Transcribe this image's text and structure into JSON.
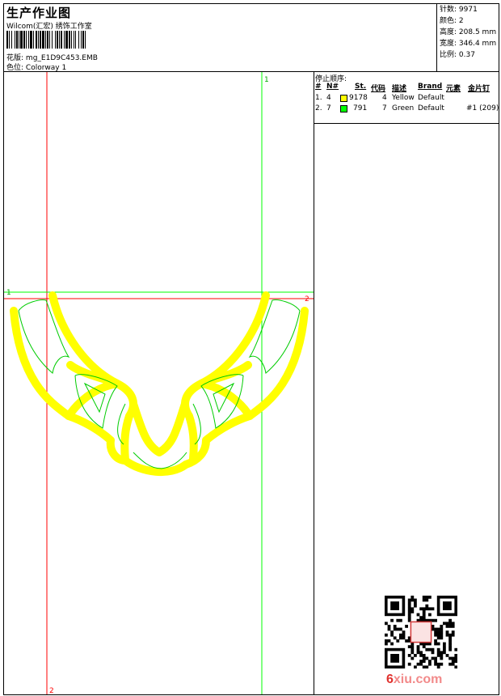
{
  "header": {
    "title": "生产作业图",
    "company": "Wilcom(汇宏) 绣饰工作室",
    "design_file_label": "花版:",
    "design_file": "mg_E1D9C453.EMB",
    "colorway_label": "色位:",
    "colorway": "Colorway 1"
  },
  "stats": [
    {
      "label": "针数:",
      "value": "9971"
    },
    {
      "label": "颜色:",
      "value": "2"
    },
    {
      "label": "高度:",
      "value": "208.5 mm"
    },
    {
      "label": "宽度:",
      "value": "346.4 mm"
    },
    {
      "label": "比例:",
      "value": "0.37"
    }
  ],
  "stop_sequence": {
    "title": "停止顺序:",
    "headers": {
      "num": "#",
      "needle": "N#",
      "st": "St.",
      "code": "代码",
      "desc": "描述",
      "brand": "Brand",
      "element": "元素",
      "sequin": "金片钉"
    },
    "rows": [
      {
        "num": "1.",
        "needle": "4",
        "color": "#ffff00",
        "st": "9178",
        "code": "4",
        "desc": "Yellow",
        "brand": "Default",
        "sequin": ""
      },
      {
        "num": "2.",
        "needle": "7",
        "color": "#00ff00",
        "st": "791",
        "code": "7",
        "desc": "Green",
        "brand": "Default",
        "sequin": "#1 (209)"
      }
    ]
  },
  "guides": {
    "green_top": "1",
    "green_left": "1",
    "red_right": "2",
    "red_bottom": "2"
  },
  "colors": {
    "yellow": "#ffff00",
    "green": "#00cc00",
    "red_guide": "#ff0000",
    "green_guide": "#00ff00"
  },
  "watermark": {
    "part1": "6",
    "part2": "xiu.com"
  }
}
